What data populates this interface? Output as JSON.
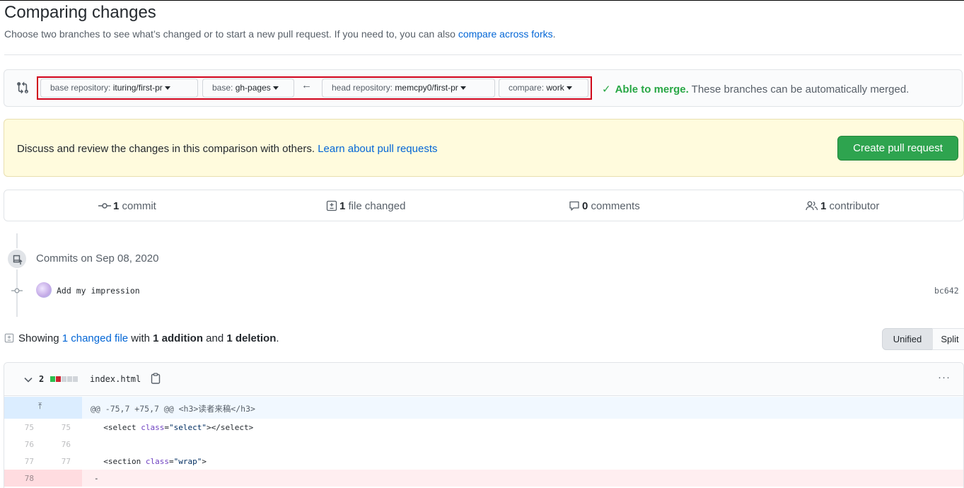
{
  "page": {
    "title": "Comparing changes",
    "subtitle": "Choose two branches to see what’s changed or to start a new pull request. If you need to, you can also",
    "subtitle_link": "compare across forks",
    "subtitle_end": "."
  },
  "range": {
    "base_repo_label": "base repository:",
    "base_repo_value": "ituring/first-pr",
    "base_label": "base:",
    "base_value": "gh-pages",
    "arrow": "←",
    "head_repo_label": "head repository:",
    "head_repo_value": "memcpy0/first-pr",
    "compare_label": "compare:",
    "compare_value": "work",
    "merge_check": "✓",
    "merge_status": "Able to merge.",
    "merge_message": "These branches can be automatically merged."
  },
  "flash": {
    "text": "Discuss and review the changes in this comparison with others.",
    "link": "Learn about pull requests",
    "button": "Create pull request"
  },
  "stats": {
    "commits_num": "1",
    "commits_label": "commit",
    "files_num": "1",
    "files_label": "file changed",
    "comments_num": "0",
    "comments_label": "comments",
    "contributors_num": "1",
    "contributors_label": "contributor"
  },
  "timeline": {
    "date": "Commits on Sep 08, 2020",
    "commit_message": "Add my impression",
    "commit_sha": "bc642"
  },
  "summary": {
    "prefix": "Showing",
    "changed_link": "1 changed file",
    "with": "with",
    "additions": "1 addition",
    "and": "and",
    "deletions": "1 deletion",
    "end": "."
  },
  "view_toggle": {
    "unified": "Unified",
    "split": "Split"
  },
  "file": {
    "diffstat_count": "2",
    "name": "index.html",
    "more": "···",
    "colors": {
      "add": "#2cbe4e",
      "del": "#cb2431",
      "neutral": "#d1d5da"
    },
    "hunk_expand": "⤒",
    "hunk_header": "@@ -75,7 +75,7 @@ <h3>读者来稿</h3>",
    "lines": [
      {
        "old": "75",
        "new": "75",
        "code_pre": "  <select ",
        "attr": "class",
        "eq": "=",
        "str": "\"select\"",
        "code_post": "></select>"
      },
      {
        "old": "76",
        "new": "76",
        "code_pre": "",
        "attr": "",
        "eq": "",
        "str": "",
        "code_post": ""
      },
      {
        "old": "77",
        "new": "77",
        "code_pre": "  <section ",
        "attr": "class",
        "eq": "=",
        "str": "\"wrap\"",
        "code_post": ">"
      },
      {
        "old": "78",
        "new": "",
        "code_pre": "-",
        "attr": "",
        "eq": "",
        "str": "",
        "code_post": ""
      }
    ]
  }
}
